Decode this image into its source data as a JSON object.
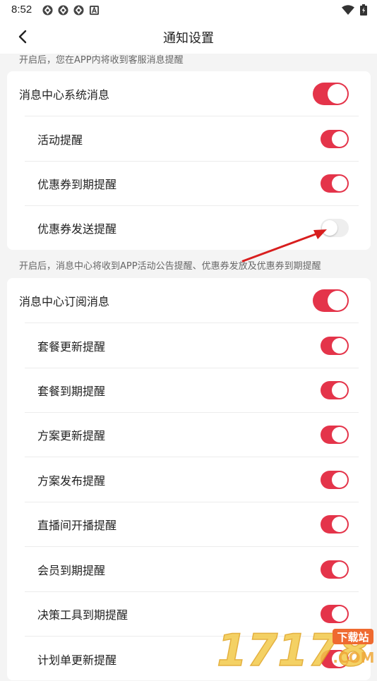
{
  "status_bar": {
    "time": "8:52",
    "notification_icons": [
      "app-icon",
      "app-icon",
      "app-icon",
      "a-icon"
    ],
    "right_icons": [
      "wifi-icon",
      "battery-icon"
    ]
  },
  "header": {
    "title": "通知设置",
    "back_icon": "chevron-left-icon"
  },
  "section1": {
    "hint": "开启后，您在APP内将收到客服消息提醒",
    "items": [
      {
        "label": "消息中心系统消息",
        "enabled": true
      },
      {
        "label": "活动提醒",
        "enabled": true
      },
      {
        "label": "优惠券到期提醒",
        "enabled": true
      },
      {
        "label": "优惠券发送提醒",
        "enabled": false
      }
    ]
  },
  "section2": {
    "hint": "开启后，消息中心将收到APP活动公告提醒、优惠券发放及优惠券到期提醒",
    "items": [
      {
        "label": "消息中心订阅消息",
        "enabled": true
      },
      {
        "label": "套餐更新提醒",
        "enabled": true
      },
      {
        "label": "套餐到期提醒",
        "enabled": true
      },
      {
        "label": "方案更新提醒",
        "enabled": true
      },
      {
        "label": "方案发布提醒",
        "enabled": true
      },
      {
        "label": "直播间开播提醒",
        "enabled": true
      },
      {
        "label": "会员到期提醒",
        "enabled": true
      },
      {
        "label": "决策工具到期提醒",
        "enabled": true
      },
      {
        "label": "计划单更新提醒",
        "enabled": true
      }
    ]
  },
  "watermark": {
    "text": "17178",
    "badge": "下载站",
    "suffix": ".COM"
  },
  "colors": {
    "accent": "#e4344a",
    "toggle_off": "#eeeeee",
    "page_bg": "#f4f4f4",
    "arrow": "#d81e1e"
  }
}
